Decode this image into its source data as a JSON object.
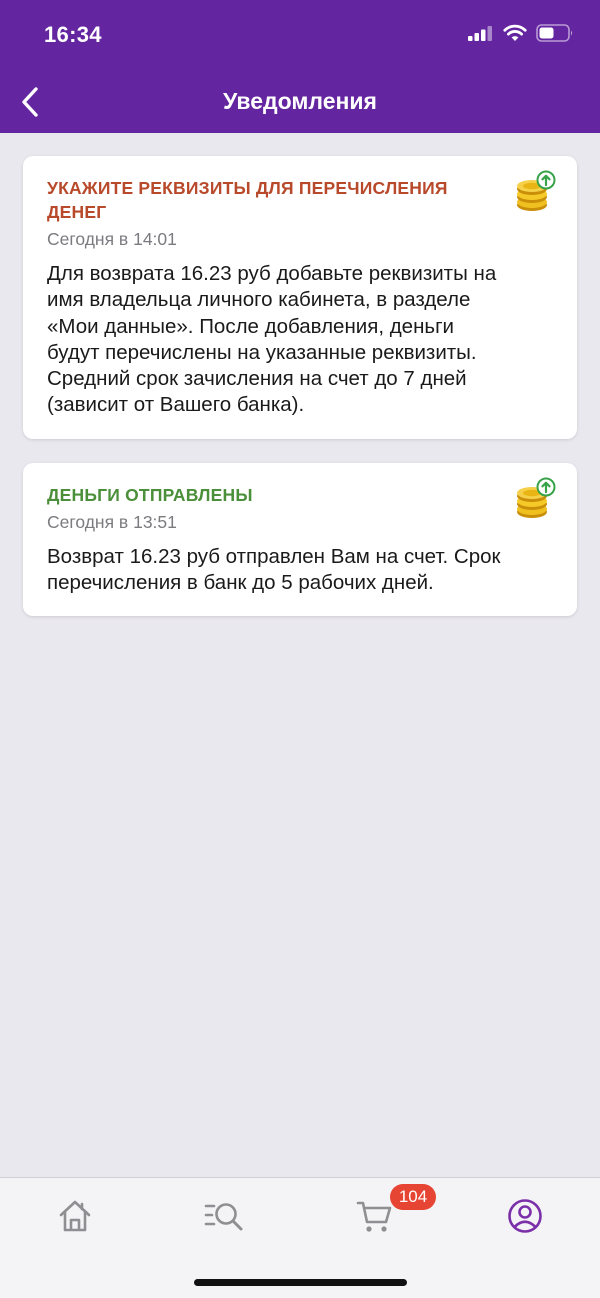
{
  "status_bar": {
    "time": "16:34"
  },
  "header": {
    "title": "Уведомления",
    "back_icon": "chevron-left-icon"
  },
  "notifications": [
    {
      "title": "УКАЖИТЕ РЕКВИЗИТЫ ДЛЯ ПЕРЕЧИСЛЕНИЯ ДЕНЕГ",
      "title_color": "#b8492a",
      "time": "Сегодня в 14:01",
      "text": "Для возврата 16.23 руб добавьте реквизиты на\nимя владельца личного кабинета,  в разделе\n«Мои данные». После добавления, деньги\nбудут перечислены на указанные реквизиты.\nСредний срок зачисления на счет до 7 дней\n(зависит от Вашего банка).",
      "icon": "coins-icon"
    },
    {
      "title": "ДЕНЬГИ ОТПРАВЛЕНЫ",
      "title_color": "#4b8f3a",
      "time": "Сегодня в 13:51",
      "text": "Возврат 16.23 руб отправлен Вам на счет. Срок\nперечисления в банк до 5 рабочих дней.",
      "icon": "coins-icon"
    }
  ],
  "tabbar": {
    "tabs": [
      {
        "icon": "home-icon",
        "active": false
      },
      {
        "icon": "search-list-icon",
        "active": false
      },
      {
        "icon": "cart-icon",
        "active": false
      },
      {
        "icon": "profile-icon",
        "active": true
      }
    ],
    "cart_badge": "104"
  },
  "colors": {
    "header_bg": "#6425a0",
    "active_tab": "#7b2fa8",
    "inactive_tab": "#8e8e93",
    "badge": "#e74533"
  }
}
